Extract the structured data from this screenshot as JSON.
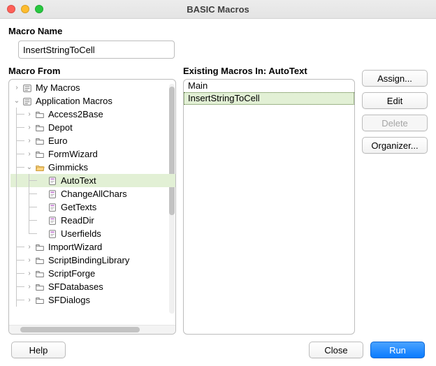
{
  "title": "BASIC Macros",
  "labels": {
    "macro_name": "Macro Name",
    "macro_from": "Macro From",
    "existing_prefix": "Existing Macros In: ",
    "existing_target": "AutoText"
  },
  "fields": {
    "macro_name_value": "InsertStringToCell"
  },
  "tree": [
    {
      "depth": 0,
      "disclosure": "right",
      "icon": "lib-root",
      "label": "My Macros"
    },
    {
      "depth": 0,
      "disclosure": "down",
      "icon": "lib-root",
      "label": "Application Macros"
    },
    {
      "depth": 1,
      "disclosure": "right",
      "icon": "folder",
      "label": "Access2Base"
    },
    {
      "depth": 1,
      "disclosure": "right",
      "icon": "folder",
      "label": "Depot"
    },
    {
      "depth": 1,
      "disclosure": "right",
      "icon": "folder",
      "label": "Euro"
    },
    {
      "depth": 1,
      "disclosure": "right",
      "icon": "folder",
      "label": "FormWizard"
    },
    {
      "depth": 1,
      "disclosure": "down",
      "icon": "folder-open",
      "label": "Gimmicks"
    },
    {
      "depth": 2,
      "disclosure": "none",
      "icon": "module",
      "label": "AutoText",
      "selected": true
    },
    {
      "depth": 2,
      "disclosure": "none",
      "icon": "module",
      "label": "ChangeAllChars"
    },
    {
      "depth": 2,
      "disclosure": "none",
      "icon": "module",
      "label": "GetTexts"
    },
    {
      "depth": 2,
      "disclosure": "none",
      "icon": "module",
      "label": "ReadDir"
    },
    {
      "depth": 2,
      "disclosure": "none",
      "icon": "module",
      "label": "Userfields",
      "last_sibling": true
    },
    {
      "depth": 1,
      "disclosure": "right",
      "icon": "folder",
      "label": "ImportWizard"
    },
    {
      "depth": 1,
      "disclosure": "right",
      "icon": "folder",
      "label": "ScriptBindingLibrary"
    },
    {
      "depth": 1,
      "disclosure": "right",
      "icon": "folder",
      "label": "ScriptForge"
    },
    {
      "depth": 1,
      "disclosure": "right",
      "icon": "folder",
      "label": "SFDatabases"
    },
    {
      "depth": 1,
      "disclosure": "right",
      "icon": "folder",
      "label": "SFDialogs"
    }
  ],
  "existing": [
    {
      "label": "Main"
    },
    {
      "label": "InsertStringToCell",
      "selected": true
    }
  ],
  "buttons": {
    "assign": {
      "label": "Assign...",
      "enabled": true
    },
    "edit": {
      "label": "Edit",
      "enabled": true
    },
    "delete": {
      "label": "Delete",
      "enabled": false
    },
    "organizer": {
      "label": "Organizer...",
      "enabled": true
    },
    "help": {
      "label": "Help"
    },
    "close": {
      "label": "Close"
    },
    "run": {
      "label": "Run"
    }
  }
}
